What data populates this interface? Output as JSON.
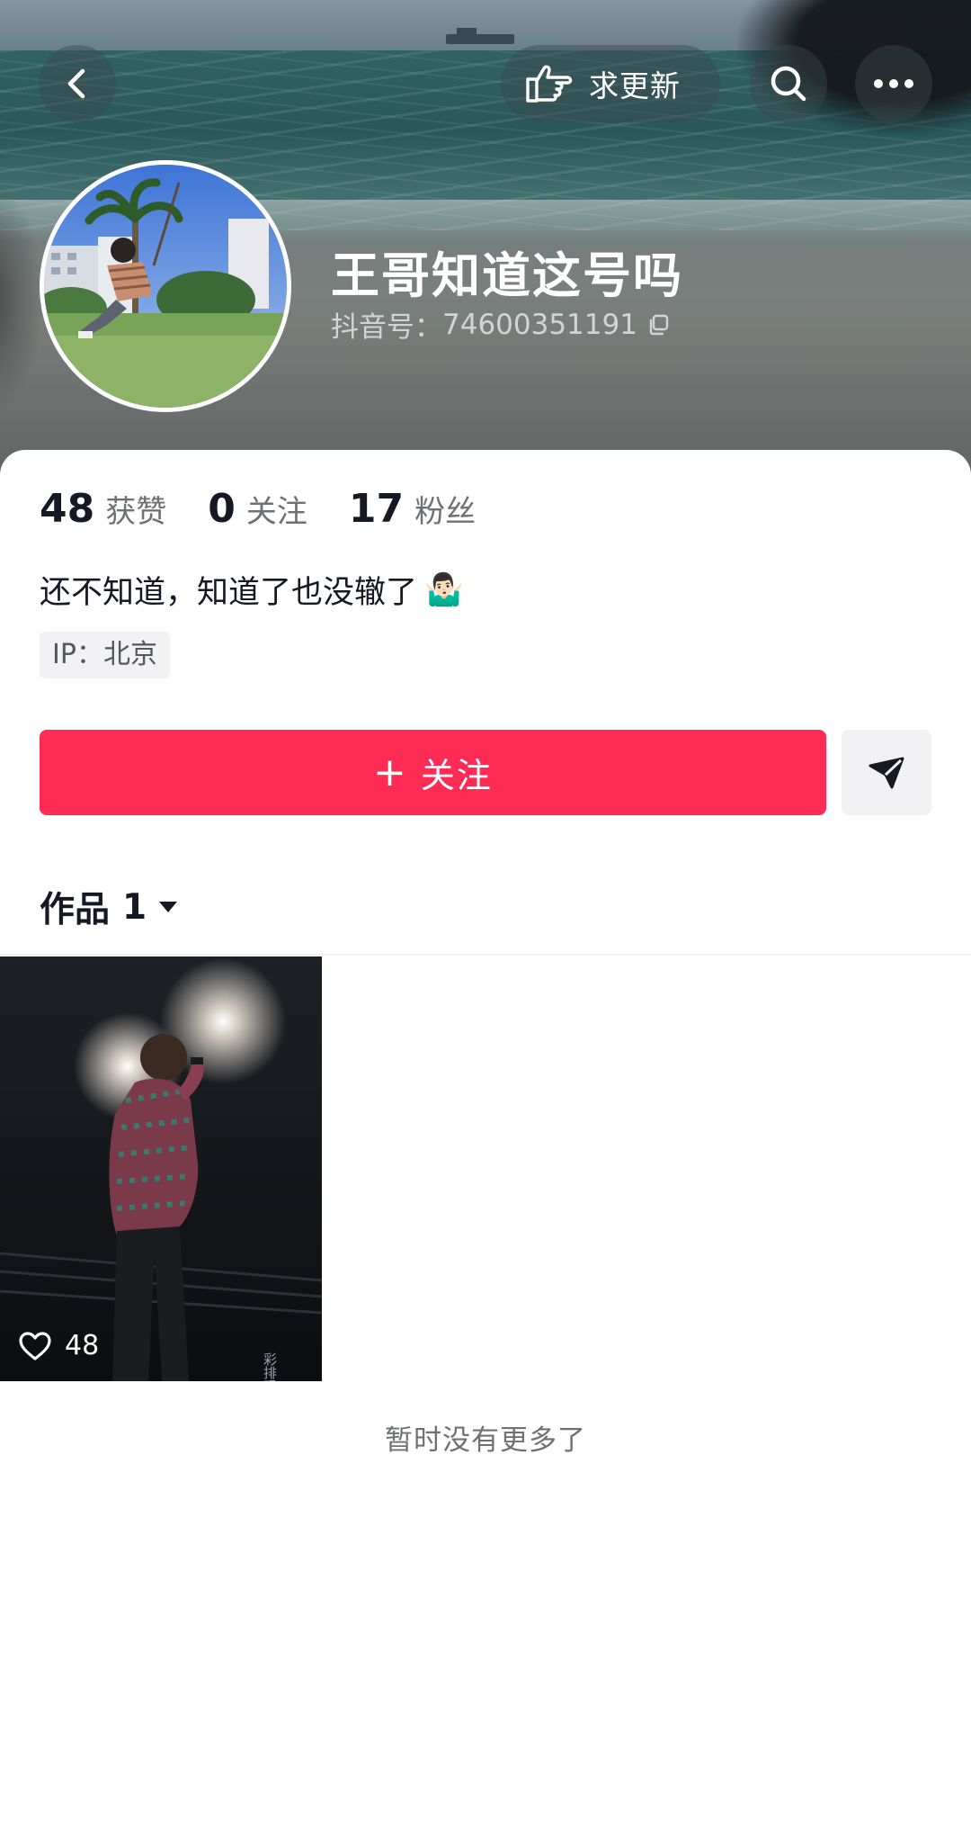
{
  "header": {
    "request_update_label": "求更新",
    "nickname": "王哥知道这号吗",
    "douyin_id_label": "抖音号：",
    "douyin_id_value": "74600351191"
  },
  "stats": [
    {
      "value": "48",
      "label": "获赞"
    },
    {
      "value": "0",
      "label": "关注"
    },
    {
      "value": "17",
      "label": "粉丝"
    }
  ],
  "profile": {
    "bio": "还不知道，知道了也没辙了",
    "bio_emoji": "🤷🏻‍♂️",
    "ip_location": "IP：北京"
  },
  "actions": {
    "follow_plus": "+",
    "follow_label": "关注"
  },
  "works": {
    "tab_label": "作品",
    "tab_count": "1",
    "videos": [
      {
        "likes": "48"
      }
    ],
    "end_message": "暂时没有更多了"
  },
  "colors": {
    "follow_button": "#fe2c55",
    "primary_text": "#161823",
    "secondary_text": "#6f7075"
  },
  "icons": [
    "back-icon",
    "hand-point-icon",
    "search-icon",
    "more-icon",
    "copy-icon",
    "send-icon",
    "caret-down-icon",
    "heart-icon"
  ]
}
